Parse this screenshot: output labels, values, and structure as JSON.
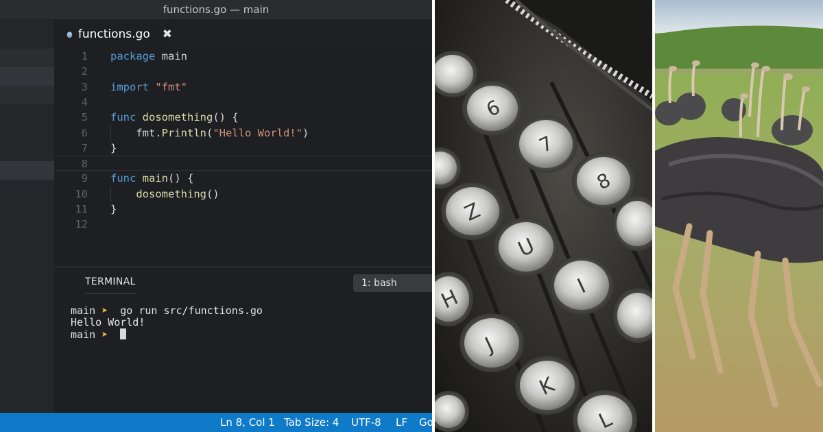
{
  "window": {
    "title": "functions.go — main"
  },
  "tab": {
    "filename": "functions.go",
    "close_glyph": "✖",
    "icon": "go-gopher-icon"
  },
  "editor": {
    "lines": [
      {
        "n": "1",
        "tokens": [
          {
            "t": "package",
            "c": "kw"
          },
          {
            "t": " main",
            "c": "ident"
          }
        ]
      },
      {
        "n": "2",
        "tokens": []
      },
      {
        "n": "3",
        "tokens": [
          {
            "t": "import",
            "c": "kw"
          },
          {
            "t": " \"fmt\"",
            "c": "str"
          }
        ]
      },
      {
        "n": "4",
        "tokens": []
      },
      {
        "n": "5",
        "tokens": [
          {
            "t": "func",
            "c": "kw"
          },
          {
            "t": " ",
            "c": "ident"
          },
          {
            "t": "dosomething",
            "c": "fn"
          },
          {
            "t": "() {",
            "c": "ident"
          }
        ]
      },
      {
        "n": "6",
        "tokens": [
          {
            "t": "    fmt.",
            "c": "ident"
          },
          {
            "t": "Println",
            "c": "fn"
          },
          {
            "t": "(",
            "c": "ident"
          },
          {
            "t": "\"Hello World!\"",
            "c": "str"
          },
          {
            "t": ")",
            "c": "ident"
          }
        ],
        "guide": true
      },
      {
        "n": "7",
        "tokens": [
          {
            "t": "}",
            "c": "ident"
          }
        ]
      },
      {
        "n": "8",
        "tokens": [],
        "current": true
      },
      {
        "n": "9",
        "tokens": [
          {
            "t": "func",
            "c": "kw"
          },
          {
            "t": " ",
            "c": "ident"
          },
          {
            "t": "main",
            "c": "fn"
          },
          {
            "t": "() {",
            "c": "ident"
          }
        ]
      },
      {
        "n": "10",
        "tokens": [
          {
            "t": "    ",
            "c": "ident"
          },
          {
            "t": "dosomething",
            "c": "fn"
          },
          {
            "t": "()",
            "c": "ident"
          }
        ],
        "guide": true
      },
      {
        "n": "11",
        "tokens": [
          {
            "t": "}",
            "c": "ident"
          }
        ]
      },
      {
        "n": "12",
        "tokens": []
      }
    ]
  },
  "terminal": {
    "tab_label": "TERMINAL",
    "shell_select": "1: bash",
    "prompt_name": "main",
    "prompt_arrow": "➤",
    "command": "go run src/functions.go",
    "output": "Hello World!"
  },
  "statusbar": {
    "position": "Ln 8, Col 1",
    "tab_size": "Tab Size: 4",
    "encoding": "UTF-8",
    "eol": "LF",
    "language": "Go"
  },
  "colors": {
    "status_blue": "#0e7ac8",
    "keyword": "#569cd6",
    "function": "#dcdcaa",
    "string": "#ce9178",
    "prompt_arrow": "#f0d030"
  }
}
